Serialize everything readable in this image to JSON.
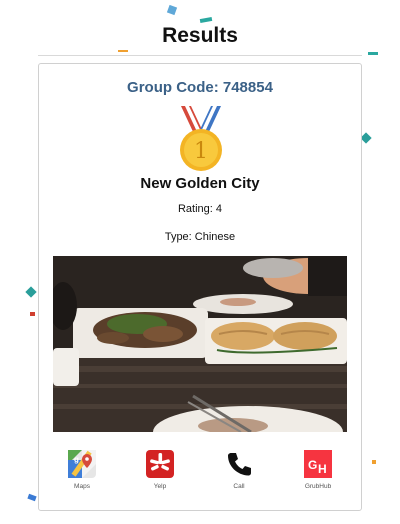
{
  "header": {
    "title": "Results"
  },
  "card": {
    "group_code": "Group Code: 748854",
    "restaurant_name": "New Golden City",
    "rating": "Rating: 4",
    "type": "Type: Chinese",
    "medal_icon": "first-place-medal-icon",
    "photo_subject": "food-photo"
  },
  "actions": [
    {
      "label": "Maps",
      "icon": "google-maps-icon"
    },
    {
      "label": "Yelp",
      "icon": "yelp-icon"
    },
    {
      "label": "Call",
      "icon": "phone-icon"
    },
    {
      "label": "GrubHub",
      "icon": "grubhub-icon"
    }
  ],
  "colors": {
    "group_code": "#3b6187",
    "confetti_teal": "#2aa8a0",
    "confetti_blue": "#3b7bd4",
    "confetti_orange": "#f0a030",
    "yelp_red": "#d32323",
    "grubhub_red": "#f63440"
  }
}
